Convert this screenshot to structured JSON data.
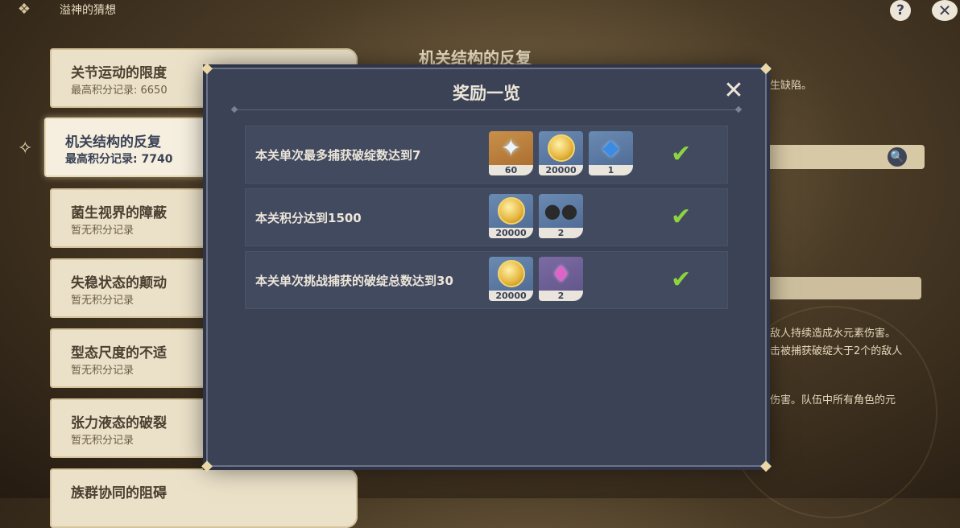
{
  "header": {
    "title": "溢神的猜想",
    "help_label": "?",
    "close_label": "✕"
  },
  "levels": [
    {
      "name": "关节运动的限度",
      "record": "最高积分记录: 6650"
    },
    {
      "name": "机关结构的反复",
      "record": "最高积分记录: 7740",
      "selected": true
    },
    {
      "name": "菌生视界的障蔽",
      "record": "暂无积分记录"
    },
    {
      "name": "失稳状态的颠动",
      "record": "暂无积分记录"
    },
    {
      "name": "型态尺度的不适",
      "record": "暂无积分记录"
    },
    {
      "name": "张力液态的破裂",
      "record": "暂无积分记录"
    },
    {
      "name": "族群协同的阻碍",
      "record": ""
    }
  ],
  "detail": {
    "title": "机关结构的反复",
    "snippets": [
      "生缺陷。",
      "敌人持续造成水元素伤害。",
      "击被捕获破绽大于2个的敌人",
      "伤害。队伍中所有角色的元"
    ]
  },
  "modal": {
    "title": "奖励一览",
    "close_label": "✕",
    "rows": [
      {
        "description": "本关单次最多捕获破绽数达到7",
        "rewards": [
          {
            "icon": "primogem-icon",
            "qty": "60"
          },
          {
            "icon": "mora-coin-icon",
            "qty": "20000"
          },
          {
            "icon": "blue-gem-icon",
            "qty": "1"
          }
        ],
        "completed": true
      },
      {
        "description": "本关积分达到1500",
        "rewards": [
          {
            "icon": "mora-coin-icon",
            "qty": "20000"
          },
          {
            "icon": "ore-icon",
            "qty": "2"
          }
        ],
        "completed": true
      },
      {
        "description": "本关单次挑战捕获的破绽总数达到30",
        "rewards": [
          {
            "icon": "mora-coin-icon",
            "qty": "20000"
          },
          {
            "icon": "crystal-icon",
            "qty": "2"
          }
        ],
        "completed": true
      }
    ]
  },
  "colors": {
    "panel": "#3b4256",
    "check": "#8fd33e",
    "card": "#ebe1c9"
  }
}
